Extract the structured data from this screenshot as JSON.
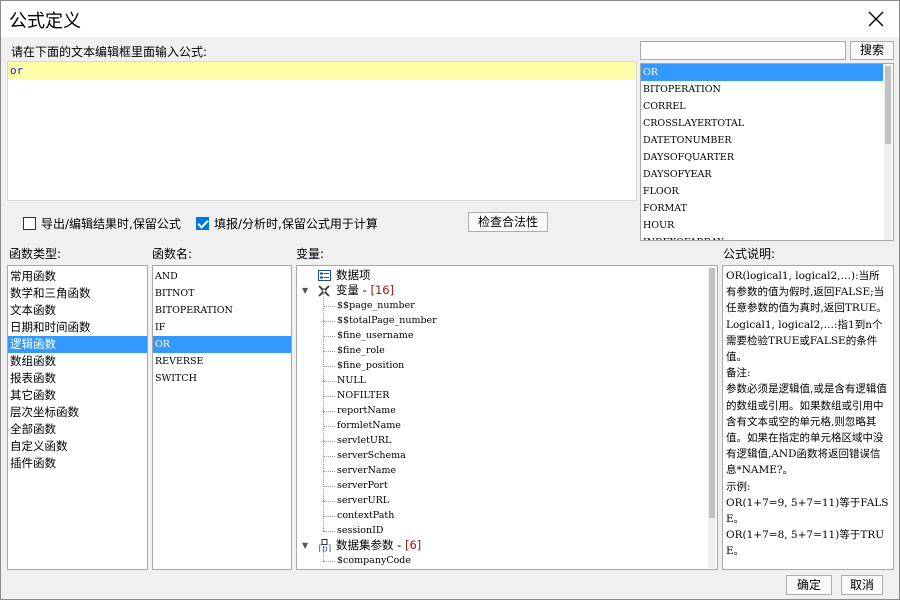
{
  "window": {
    "title": "公式定义"
  },
  "editor": {
    "label": "请在下面的文本编辑框里面输入公式:",
    "text": "or"
  },
  "search": {
    "value": "",
    "button": "搜索"
  },
  "search_results": [
    "OR",
    "BITOPERATION",
    "CORREL",
    "CROSSLAYERTOTAL",
    "DATETONUMBER",
    "DAYSOFQUARTER",
    "DAYSOFYEAR",
    "FLOOR",
    "FORMAT",
    "HOUR",
    "INDEXOFARRAY"
  ],
  "options": {
    "keep_formula_export": {
      "label": "导出/编辑结果时,保留公式",
      "checked": false
    },
    "keep_formula_fill": {
      "label": "填报/分析时,保留公式用于计算",
      "checked": true
    },
    "check_button": "检查合法性"
  },
  "sections": {
    "types": "函数类型:",
    "names": "函数名:",
    "vars": "变量:",
    "desc": "公式说明:"
  },
  "function_types": [
    "常用函数",
    "数学和三角函数",
    "文本函数",
    "日期和时间函数",
    "逻辑函数",
    "数组函数",
    "报表函数",
    "其它函数",
    "层次坐标函数",
    "全部函数",
    "自定义函数",
    "插件函数"
  ],
  "function_names": [
    "AND",
    "BITNOT",
    "BITOPERATION",
    "IF",
    "OR",
    "REVERSE",
    "SWITCH"
  ],
  "variables": {
    "datasource": "数据项",
    "var_group": "变量",
    "var_count": "[16]",
    "items": [
      "$$page_number",
      "$$totalPage_number",
      "$fine_username",
      "$fine_role",
      "$fine_position",
      "NULL",
      "NOFILTER",
      "reportName",
      "formletName",
      "servletURL",
      "serverSchema",
      "serverName",
      "serverPort",
      "serverURL",
      "contextPath",
      "sessionID"
    ],
    "dataset_group": "数据集参数",
    "dataset_count": "[6]",
    "dataset_items": [
      "$companyCode"
    ]
  },
  "description": {
    "lines": [
      "OR(logical1, logical2,…):当所有参数的值为假时,返回FALSE;当任意参数的值为真时,返回TRUE。",
      "Logical1, logical2,…:指1到n个需要检验TRUE或FALSE的条件值。",
      "备注:",
      "参数必须是逻辑值,或是含有逻辑值的数组或引用。如果数组或引用中含有文本或空的单元格,则忽略其值。如果在指定的单元格区域中没有逻辑值,AND函数将返回错误信息*NAME?。",
      "示例:",
      "OR(1+7=9, 5+7=11)等于FALSE。",
      "OR(1+7=8, 5+7=11)等于TRUE。"
    ]
  },
  "buttons": {
    "ok": "确定",
    "cancel": "取消"
  }
}
